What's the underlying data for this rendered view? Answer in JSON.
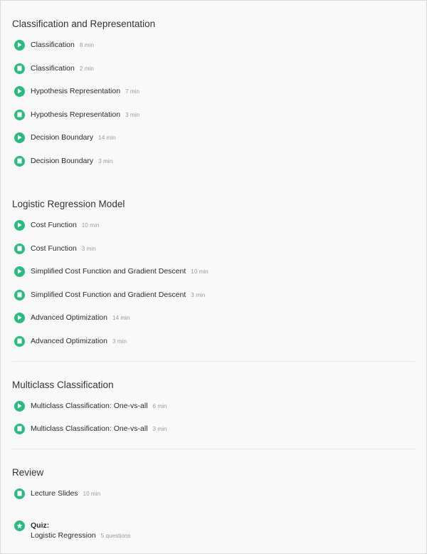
{
  "colors": {
    "accent": "#2abb7f",
    "meta_text": "#9a9a9a",
    "background": "#f9f9f9"
  },
  "sections": [
    {
      "title": "Classification and Representation",
      "items": [
        {
          "type": "video",
          "icon": "play-icon",
          "label": "Classification",
          "meta": "8 min"
        },
        {
          "type": "reading",
          "icon": "reading-icon",
          "label": "Classification",
          "meta": "2 min"
        },
        {
          "type": "video",
          "icon": "play-icon",
          "label": "Hypothesis Representation",
          "meta": "7 min"
        },
        {
          "type": "reading",
          "icon": "reading-icon",
          "label": "Hypothesis Representation",
          "meta": "3 min"
        },
        {
          "type": "video",
          "icon": "play-icon",
          "label": "Decision Boundary",
          "meta": "14 min"
        },
        {
          "type": "reading",
          "icon": "reading-icon",
          "label": "Decision Boundary",
          "meta": "3 min"
        }
      ]
    },
    {
      "title": "Logistic Regression Model",
      "items": [
        {
          "type": "video",
          "icon": "play-icon",
          "label": "Cost Function",
          "meta": "10 min"
        },
        {
          "type": "reading",
          "icon": "reading-icon",
          "label": "Cost Function",
          "meta": "3 min"
        },
        {
          "type": "video",
          "icon": "play-icon",
          "label": "Simplified Cost Function and Gradient Descent",
          "meta": "10 min"
        },
        {
          "type": "reading",
          "icon": "reading-icon",
          "label": "Simplified Cost Function and Gradient Descent",
          "meta": "3 min"
        },
        {
          "type": "video",
          "icon": "play-icon",
          "label": "Advanced Optimization",
          "meta": "14 min"
        },
        {
          "type": "reading",
          "icon": "reading-icon",
          "label": "Advanced Optimization",
          "meta": "3 min"
        }
      ]
    },
    {
      "title": "Multiclass Classification",
      "items": [
        {
          "type": "video",
          "icon": "play-icon",
          "label": "Multiclass Classification: One-vs-all",
          "meta": "6 min"
        },
        {
          "type": "reading",
          "icon": "reading-icon",
          "label": "Multiclass Classification: One-vs-all",
          "meta": "3 min"
        }
      ]
    },
    {
      "title": "Review",
      "items": [
        {
          "type": "reading",
          "icon": "reading-icon",
          "label": "Lecture Slides",
          "meta": "10 min"
        }
      ]
    }
  ],
  "quiz": {
    "icon": "star-icon",
    "title": "Quiz:",
    "label": "Logistic Regression",
    "meta": "5 questions"
  }
}
